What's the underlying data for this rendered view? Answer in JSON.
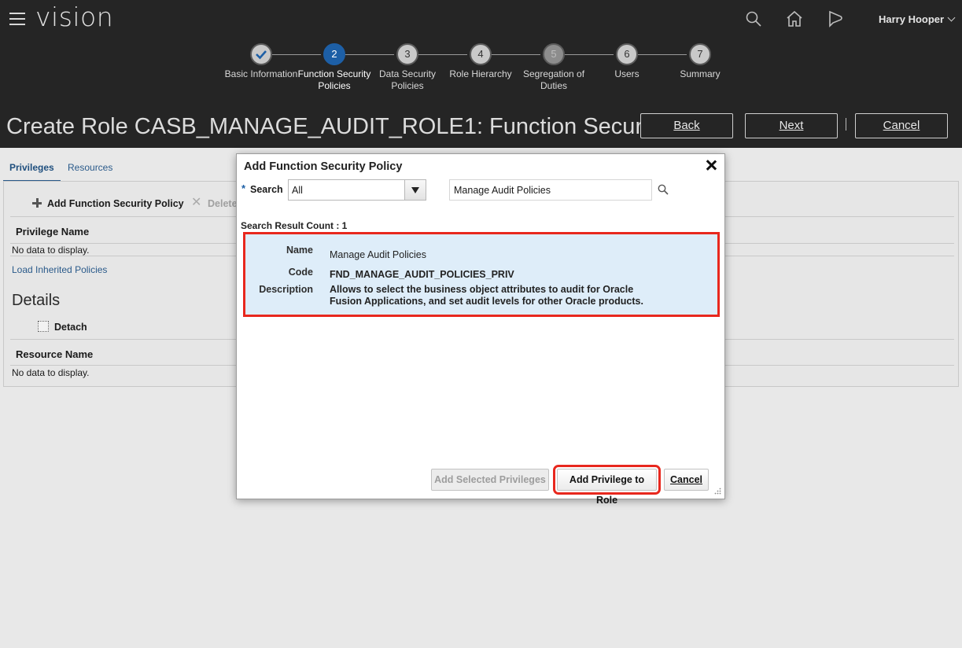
{
  "header": {
    "brand": "vision",
    "user_name": "Harry Hooper"
  },
  "train": [
    {
      "number": "✓",
      "label": "Basic Information",
      "state": "done"
    },
    {
      "number": "2",
      "label": "Function Security Policies",
      "state": "current"
    },
    {
      "number": "3",
      "label": "Data Security Policies",
      "state": "todo"
    },
    {
      "number": "4",
      "label": "Role Hierarchy",
      "state": "todo"
    },
    {
      "number": "5",
      "label": "Segregation of Duties",
      "state": "disabled"
    },
    {
      "number": "6",
      "label": "Users",
      "state": "todo"
    },
    {
      "number": "7",
      "label": "Summary",
      "state": "todo"
    }
  ],
  "page": {
    "title": "Create Role CASB_MANAGE_AUDIT_ROLE1: Function Securi...",
    "back_label": "Back",
    "next_label": "Next",
    "cancel_label": "Cancel"
  },
  "content": {
    "tabs": [
      "Privileges",
      "Resources"
    ],
    "add_policy_label": "Add Function Security Policy",
    "delete_label": "Delete",
    "privilege_name_header": "Privilege Name",
    "no_data_1": "No data to display.",
    "load_inherited_link": "Load Inherited Policies",
    "details_heading": "Details",
    "detach_label": "Detach",
    "resource_name_header": "Resource Name",
    "no_data_2": "No data to display."
  },
  "dialog": {
    "title": "Add Function Security Policy",
    "required_mark": "*",
    "search_label": "Search",
    "search_scope": "All",
    "search_text": "Manage Audit Policies",
    "result_count_label": "Search Result Count : 1",
    "result": {
      "name_label": "Name",
      "name_value": "Manage Audit Policies",
      "code_label": "Code",
      "code_value": "FND_MANAGE_AUDIT_POLICIES_PRIV",
      "description_label": "Description",
      "description_value": "Allows to select the business object attributes to audit for Oracle Fusion Applications, and set audit levels for other Oracle products."
    },
    "add_selected_label": "Add Selected Privileges",
    "add_to_role_label": "Add Privilege to Role",
    "cancel_label": "Cancel"
  }
}
